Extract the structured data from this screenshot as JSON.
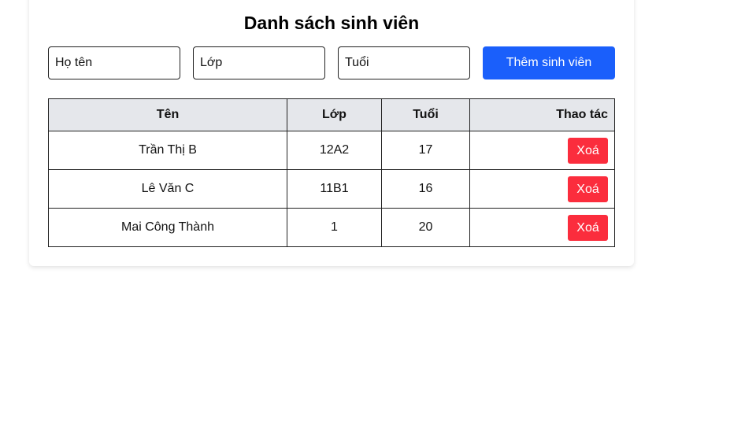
{
  "page": {
    "title": "Danh sách sinh viên"
  },
  "form": {
    "name_placeholder": "Họ tên",
    "class_placeholder": "Lớp",
    "age_placeholder": "Tuổi",
    "add_label": "Thêm sinh viên"
  },
  "table": {
    "headers": {
      "name": "Tên",
      "class": "Lớp",
      "age": "Tuổi",
      "actions": "Thao tác"
    },
    "rows": [
      {
        "name": "Trần Thị B",
        "class": "12A2",
        "age": "17",
        "action": "Xoá"
      },
      {
        "name": "Lê Văn C",
        "class": "11B1",
        "age": "16",
        "action": "Xoá"
      },
      {
        "name": "Mai Công Thành",
        "class": "1",
        "age": "20",
        "action": "Xoá"
      }
    ]
  },
  "colors": {
    "primary": "#1a5ffb",
    "danger": "#fb2d3d",
    "header_bg": "#e5e7eb"
  }
}
